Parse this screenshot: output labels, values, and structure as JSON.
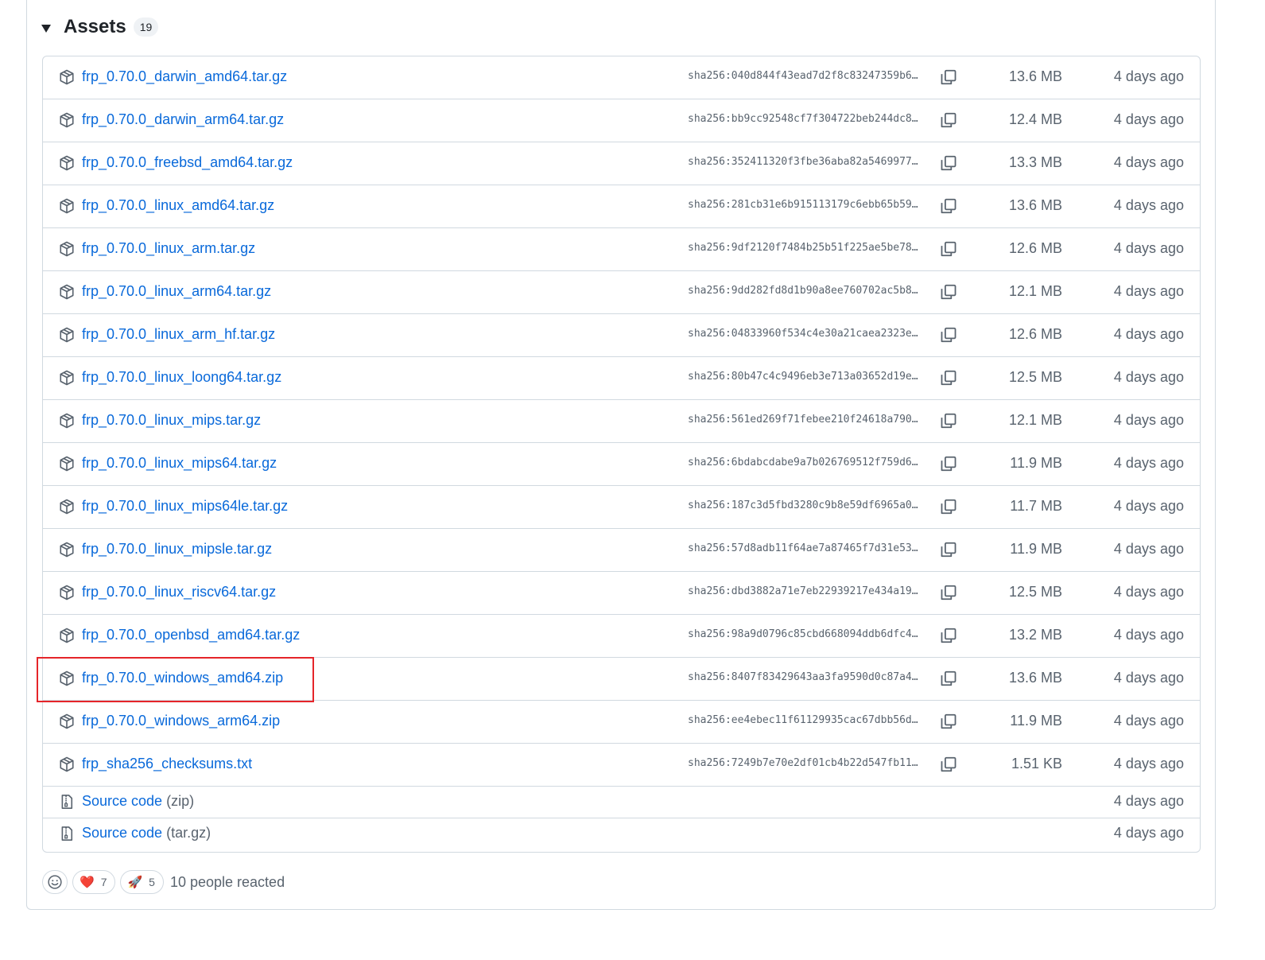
{
  "assets": {
    "title": "Assets",
    "count": "19",
    "items": [
      {
        "name": "frp_0.70.0_darwin_amd64.tar.gz",
        "sha": "sha256:040d844f43ead7d2f8c83247359b6…",
        "size": "13.6 MB",
        "date": "4 days ago"
      },
      {
        "name": "frp_0.70.0_darwin_arm64.tar.gz",
        "sha": "sha256:bb9cc92548cf7f304722beb244dc8…",
        "size": "12.4 MB",
        "date": "4 days ago"
      },
      {
        "name": "frp_0.70.0_freebsd_amd64.tar.gz",
        "sha": "sha256:352411320f3fbe36aba82a5469977…",
        "size": "13.3 MB",
        "date": "4 days ago"
      },
      {
        "name": "frp_0.70.0_linux_amd64.tar.gz",
        "sha": "sha256:281cb31e6b915113179c6ebb65b59…",
        "size": "13.6 MB",
        "date": "4 days ago"
      },
      {
        "name": "frp_0.70.0_linux_arm.tar.gz",
        "sha": "sha256:9df2120f7484b25b51f225ae5be78…",
        "size": "12.6 MB",
        "date": "4 days ago"
      },
      {
        "name": "frp_0.70.0_linux_arm64.tar.gz",
        "sha": "sha256:9dd282fd8d1b90a8ee760702ac5b8…",
        "size": "12.1 MB",
        "date": "4 days ago"
      },
      {
        "name": "frp_0.70.0_linux_arm_hf.tar.gz",
        "sha": "sha256:04833960f534c4e30a21caea2323e…",
        "size": "12.6 MB",
        "date": "4 days ago"
      },
      {
        "name": "frp_0.70.0_linux_loong64.tar.gz",
        "sha": "sha256:80b47c4c9496eb3e713a03652d19e…",
        "size": "12.5 MB",
        "date": "4 days ago"
      },
      {
        "name": "frp_0.70.0_linux_mips.tar.gz",
        "sha": "sha256:561ed269f71febee210f24618a790…",
        "size": "12.1 MB",
        "date": "4 days ago"
      },
      {
        "name": "frp_0.70.0_linux_mips64.tar.gz",
        "sha": "sha256:6bdabcdabe9a7b026769512f759d6…",
        "size": "11.9 MB",
        "date": "4 days ago"
      },
      {
        "name": "frp_0.70.0_linux_mips64le.tar.gz",
        "sha": "sha256:187c3d5fbd3280c9b8e59df6965a0…",
        "size": "11.7 MB",
        "date": "4 days ago"
      },
      {
        "name": "frp_0.70.0_linux_mipsle.tar.gz",
        "sha": "sha256:57d8adb11f64ae7a87465f7d31e53…",
        "size": "11.9 MB",
        "date": "4 days ago"
      },
      {
        "name": "frp_0.70.0_linux_riscv64.tar.gz",
        "sha": "sha256:dbd3882a71e7eb22939217e434a19…",
        "size": "12.5 MB",
        "date": "4 days ago"
      },
      {
        "name": "frp_0.70.0_openbsd_amd64.tar.gz",
        "sha": "sha256:98a9d0796c85cbd668094ddb6dfc4…",
        "size": "13.2 MB",
        "date": "4 days ago"
      },
      {
        "name": "frp_0.70.0_windows_amd64.zip",
        "sha": "sha256:8407f83429643aa3fa9590d0c87a4…",
        "size": "13.6 MB",
        "date": "4 days ago"
      },
      {
        "name": "frp_0.70.0_windows_arm64.zip",
        "sha": "sha256:ee4ebec11f61129935cac67dbb56d…",
        "size": "11.9 MB",
        "date": "4 days ago"
      },
      {
        "name": "frp_sha256_checksums.txt",
        "sha": "sha256:7249b7e70e2df01cb4b22d547fb11…",
        "size": "1.51 KB",
        "date": "4 days ago"
      }
    ],
    "source": [
      {
        "name": "Source code",
        "suffix": "(zip)",
        "date": "4 days ago"
      },
      {
        "name": "Source code",
        "suffix": "(tar.gz)",
        "date": "4 days ago"
      }
    ]
  },
  "reactions": {
    "heart_emoji": "❤️",
    "heart_count": "7",
    "rocket_emoji": "🚀",
    "rocket_count": "5",
    "summary": "10 people reacted"
  },
  "colors": {
    "link": "#0969da",
    "muted": "#59636e",
    "border": "#d1d9e0",
    "highlight": "#e5252a"
  }
}
